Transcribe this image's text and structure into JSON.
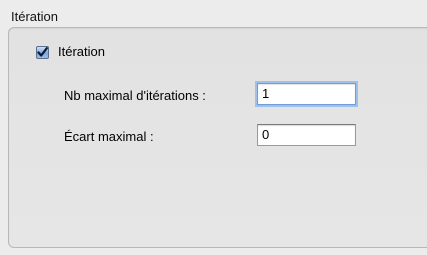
{
  "group": {
    "title": "Itération"
  },
  "iteration_checkbox": {
    "label": "Itération",
    "checked": true
  },
  "fields": {
    "max_iterations": {
      "label": "Nb maximal d'itérations :",
      "value": "1",
      "focused": true
    },
    "max_deviation": {
      "label": "Écart maximal :",
      "value": "0",
      "focused": false
    }
  },
  "colors": {
    "window_background": "#ececec",
    "focus_ring": "#9dc0ec",
    "checkbox_blue": "#7ea6dd"
  }
}
